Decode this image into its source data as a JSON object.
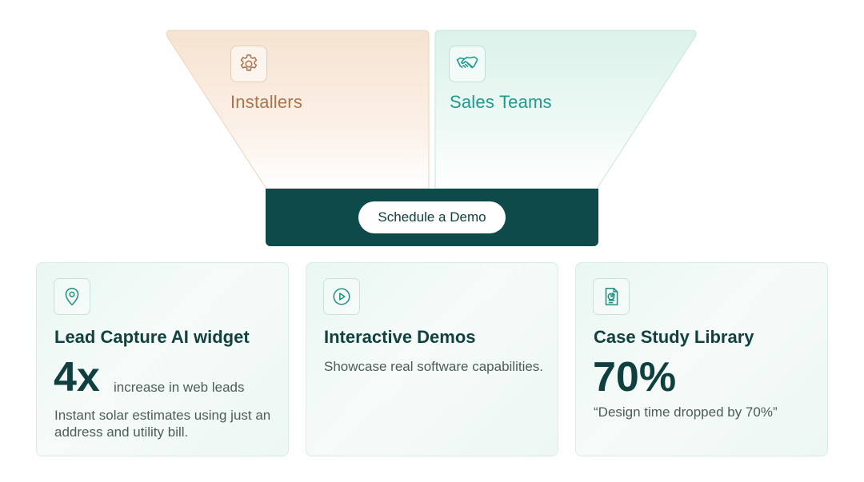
{
  "funnel": {
    "left": {
      "title": "Installers",
      "icon": "gear-icon",
      "color": "#a9744f"
    },
    "right": {
      "title": "Sales Teams",
      "icon": "handshake-icon",
      "color": "#1f9a8c"
    },
    "bar_color": "#0f4a4b",
    "cta_label": "Schedule a Demo"
  },
  "cards": [
    {
      "icon": "map-pin-icon",
      "title": "Lead Capture AI widget",
      "stat": "4x",
      "stat_caption": "increase in web leads",
      "description": "Instant solar estimates using just an address and utility bill."
    },
    {
      "icon": "play-circle-icon",
      "title": "Interactive Demos",
      "description": "Showcase real software capabilities."
    },
    {
      "icon": "document-chart-icon",
      "title": "Case Study Library",
      "stat": "70%",
      "description": "“Design time dropped by 70%”"
    }
  ]
}
